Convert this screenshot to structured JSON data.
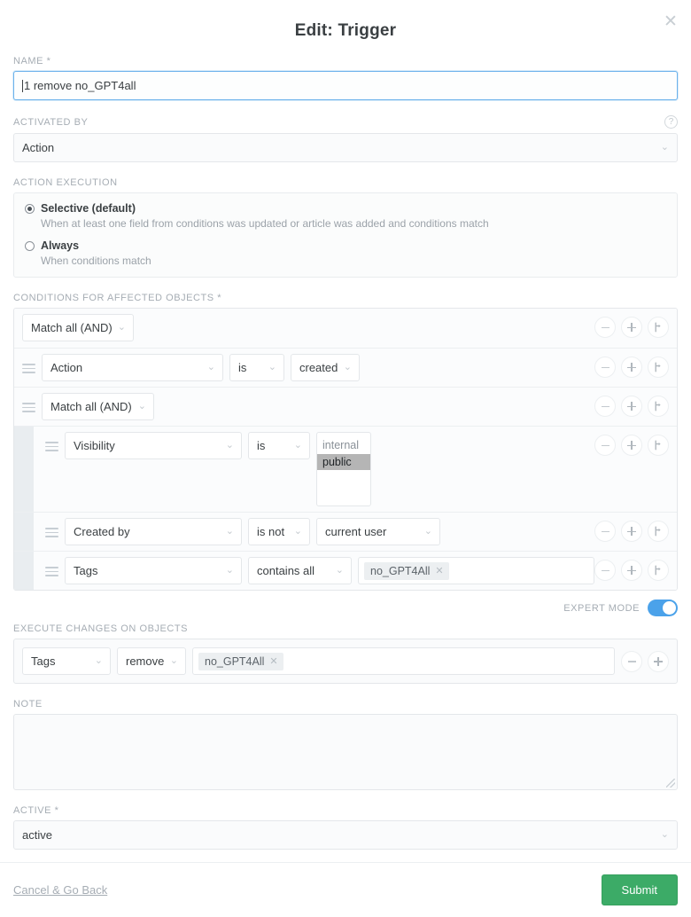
{
  "modal": {
    "title": "Edit: Trigger",
    "close_icon": "close-icon"
  },
  "name_field": {
    "label": "NAME *",
    "value": "1 remove no_GPT4all",
    "placeholder": ""
  },
  "activated_by": {
    "label": "ACTIVATED BY",
    "value": "Action",
    "help_icon": "help-circle-icon"
  },
  "action_execution": {
    "label": "ACTION EXECUTION",
    "options": [
      {
        "title": "Selective (default)",
        "description": "When at least one field from conditions was updated or article was added and conditions match",
        "selected": true
      },
      {
        "title": "Always",
        "description": "When conditions match",
        "selected": false
      }
    ]
  },
  "conditions": {
    "label": "CONDITIONS FOR AFFECTED OBJECTS *",
    "rows": [
      {
        "level": 0,
        "kind": "group",
        "match": "Match all (AND)",
        "handle": false,
        "actions": [
          "minus",
          "plus",
          "branch"
        ]
      },
      {
        "level": 1,
        "kind": "condition",
        "attribute": "Action",
        "operator": "is",
        "value": "created",
        "handle": true,
        "actions": [
          "minus",
          "plus",
          "branch"
        ]
      },
      {
        "level": 1,
        "kind": "group",
        "match": "Match all (AND)",
        "handle": true,
        "actions": [
          "minus",
          "plus",
          "branch"
        ]
      },
      {
        "level": 2,
        "kind": "multiselect",
        "attribute": "Visibility",
        "operator": "is",
        "options": [
          {
            "label": "internal",
            "selected": false
          },
          {
            "label": "public",
            "selected": true
          }
        ],
        "handle": true,
        "actions": [
          "minus",
          "plus",
          "branch"
        ]
      },
      {
        "level": 2,
        "kind": "condition",
        "attribute": "Created by",
        "operator": "is not",
        "value": "current user",
        "handle": true,
        "actions": [
          "minus",
          "plus",
          "branch"
        ]
      },
      {
        "level": 2,
        "kind": "tags",
        "attribute": "Tags",
        "operator": "contains all",
        "tags": [
          "no_GPT4All"
        ],
        "handle": true,
        "actions": [
          "minus",
          "plus",
          "branch"
        ]
      }
    ]
  },
  "expert_mode": {
    "label": "EXPERT MODE",
    "enabled": true
  },
  "execute_changes": {
    "label": "EXECUTE CHANGES ON OBJECTS",
    "attribute": "Tags",
    "operator": "remove",
    "tags": [
      "no_GPT4All"
    ],
    "actions": [
      "minus",
      "plus"
    ]
  },
  "note": {
    "label": "NOTE",
    "value": "",
    "placeholder": ""
  },
  "active": {
    "label": "ACTIVE *",
    "value": "active"
  },
  "footer": {
    "cancel_label": "Cancel & Go Back",
    "submit_label": "Submit"
  },
  "icons": {
    "chevron_down": "⌄",
    "close": "✕",
    "help": "?",
    "chip_remove": "✕"
  },
  "colors": {
    "accent_blue": "#4ba2ea",
    "submit_green": "#3cab67",
    "label_gray": "#a6adb4",
    "selected_option": "#b5b5b5"
  }
}
